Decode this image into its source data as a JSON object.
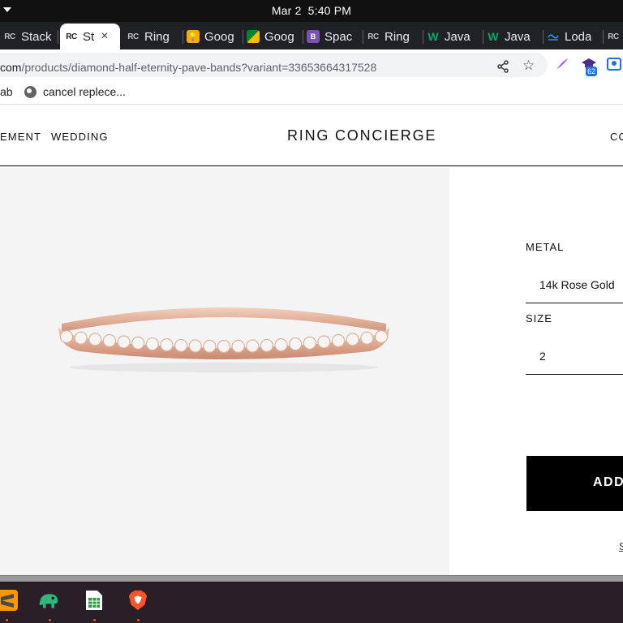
{
  "system": {
    "date": "Mar 2",
    "time": "5:40 PM"
  },
  "tabs": [
    {
      "favicon": "RC",
      "title": "Stack",
      "active": false
    },
    {
      "favicon": "RC",
      "title": "St",
      "active": true,
      "close_glyph": "×"
    },
    {
      "favicon": "RC",
      "title": "Ring",
      "active": false
    },
    {
      "favicon": "",
      "title": "Goog",
      "active": false
    },
    {
      "favicon": "",
      "title": "Goog",
      "active": false
    },
    {
      "favicon": "B",
      "title": "Spac",
      "active": false
    },
    {
      "favicon": "RC",
      "title": "Ring",
      "active": false
    },
    {
      "favicon": "W",
      "title": "Java",
      "active": false
    },
    {
      "favicon": "W",
      "title": "Java",
      "active": false
    },
    {
      "favicon": "_",
      "title": "Loda",
      "active": false
    },
    {
      "favicon": "RC",
      "title": "",
      "active": false
    }
  ],
  "address_bar": {
    "url_prefix": "com",
    "url_path": "/products/diamond-half-eternity-pave-bands?variant=33653664317528",
    "extension_badge": "62"
  },
  "bookmarks": [
    {
      "label": "ab"
    },
    {
      "label": "cancel replece..."
    }
  ],
  "site": {
    "brand": "RING CONCIERGE",
    "nav": [
      "EMENT",
      "WEDDING",
      "CC"
    ]
  },
  "product": {
    "metal_label": "METAL",
    "metal_value": "14k Rose Gold",
    "size_label": "SIZE",
    "size_value": "2",
    "add_button": "ADD",
    "small_link": "S"
  },
  "colors": {
    "accent": "#000000",
    "tab_strip": "#202124",
    "image_bg": "#f4f4f4",
    "ring_gold": "#e0a98f",
    "dock": "#2b1f27"
  },
  "dock": [
    {
      "icon": "sublime-text-icon"
    },
    {
      "icon": "chameleon-icon"
    },
    {
      "icon": "spreadsheet-icon"
    },
    {
      "icon": "brave-browser-icon"
    }
  ]
}
